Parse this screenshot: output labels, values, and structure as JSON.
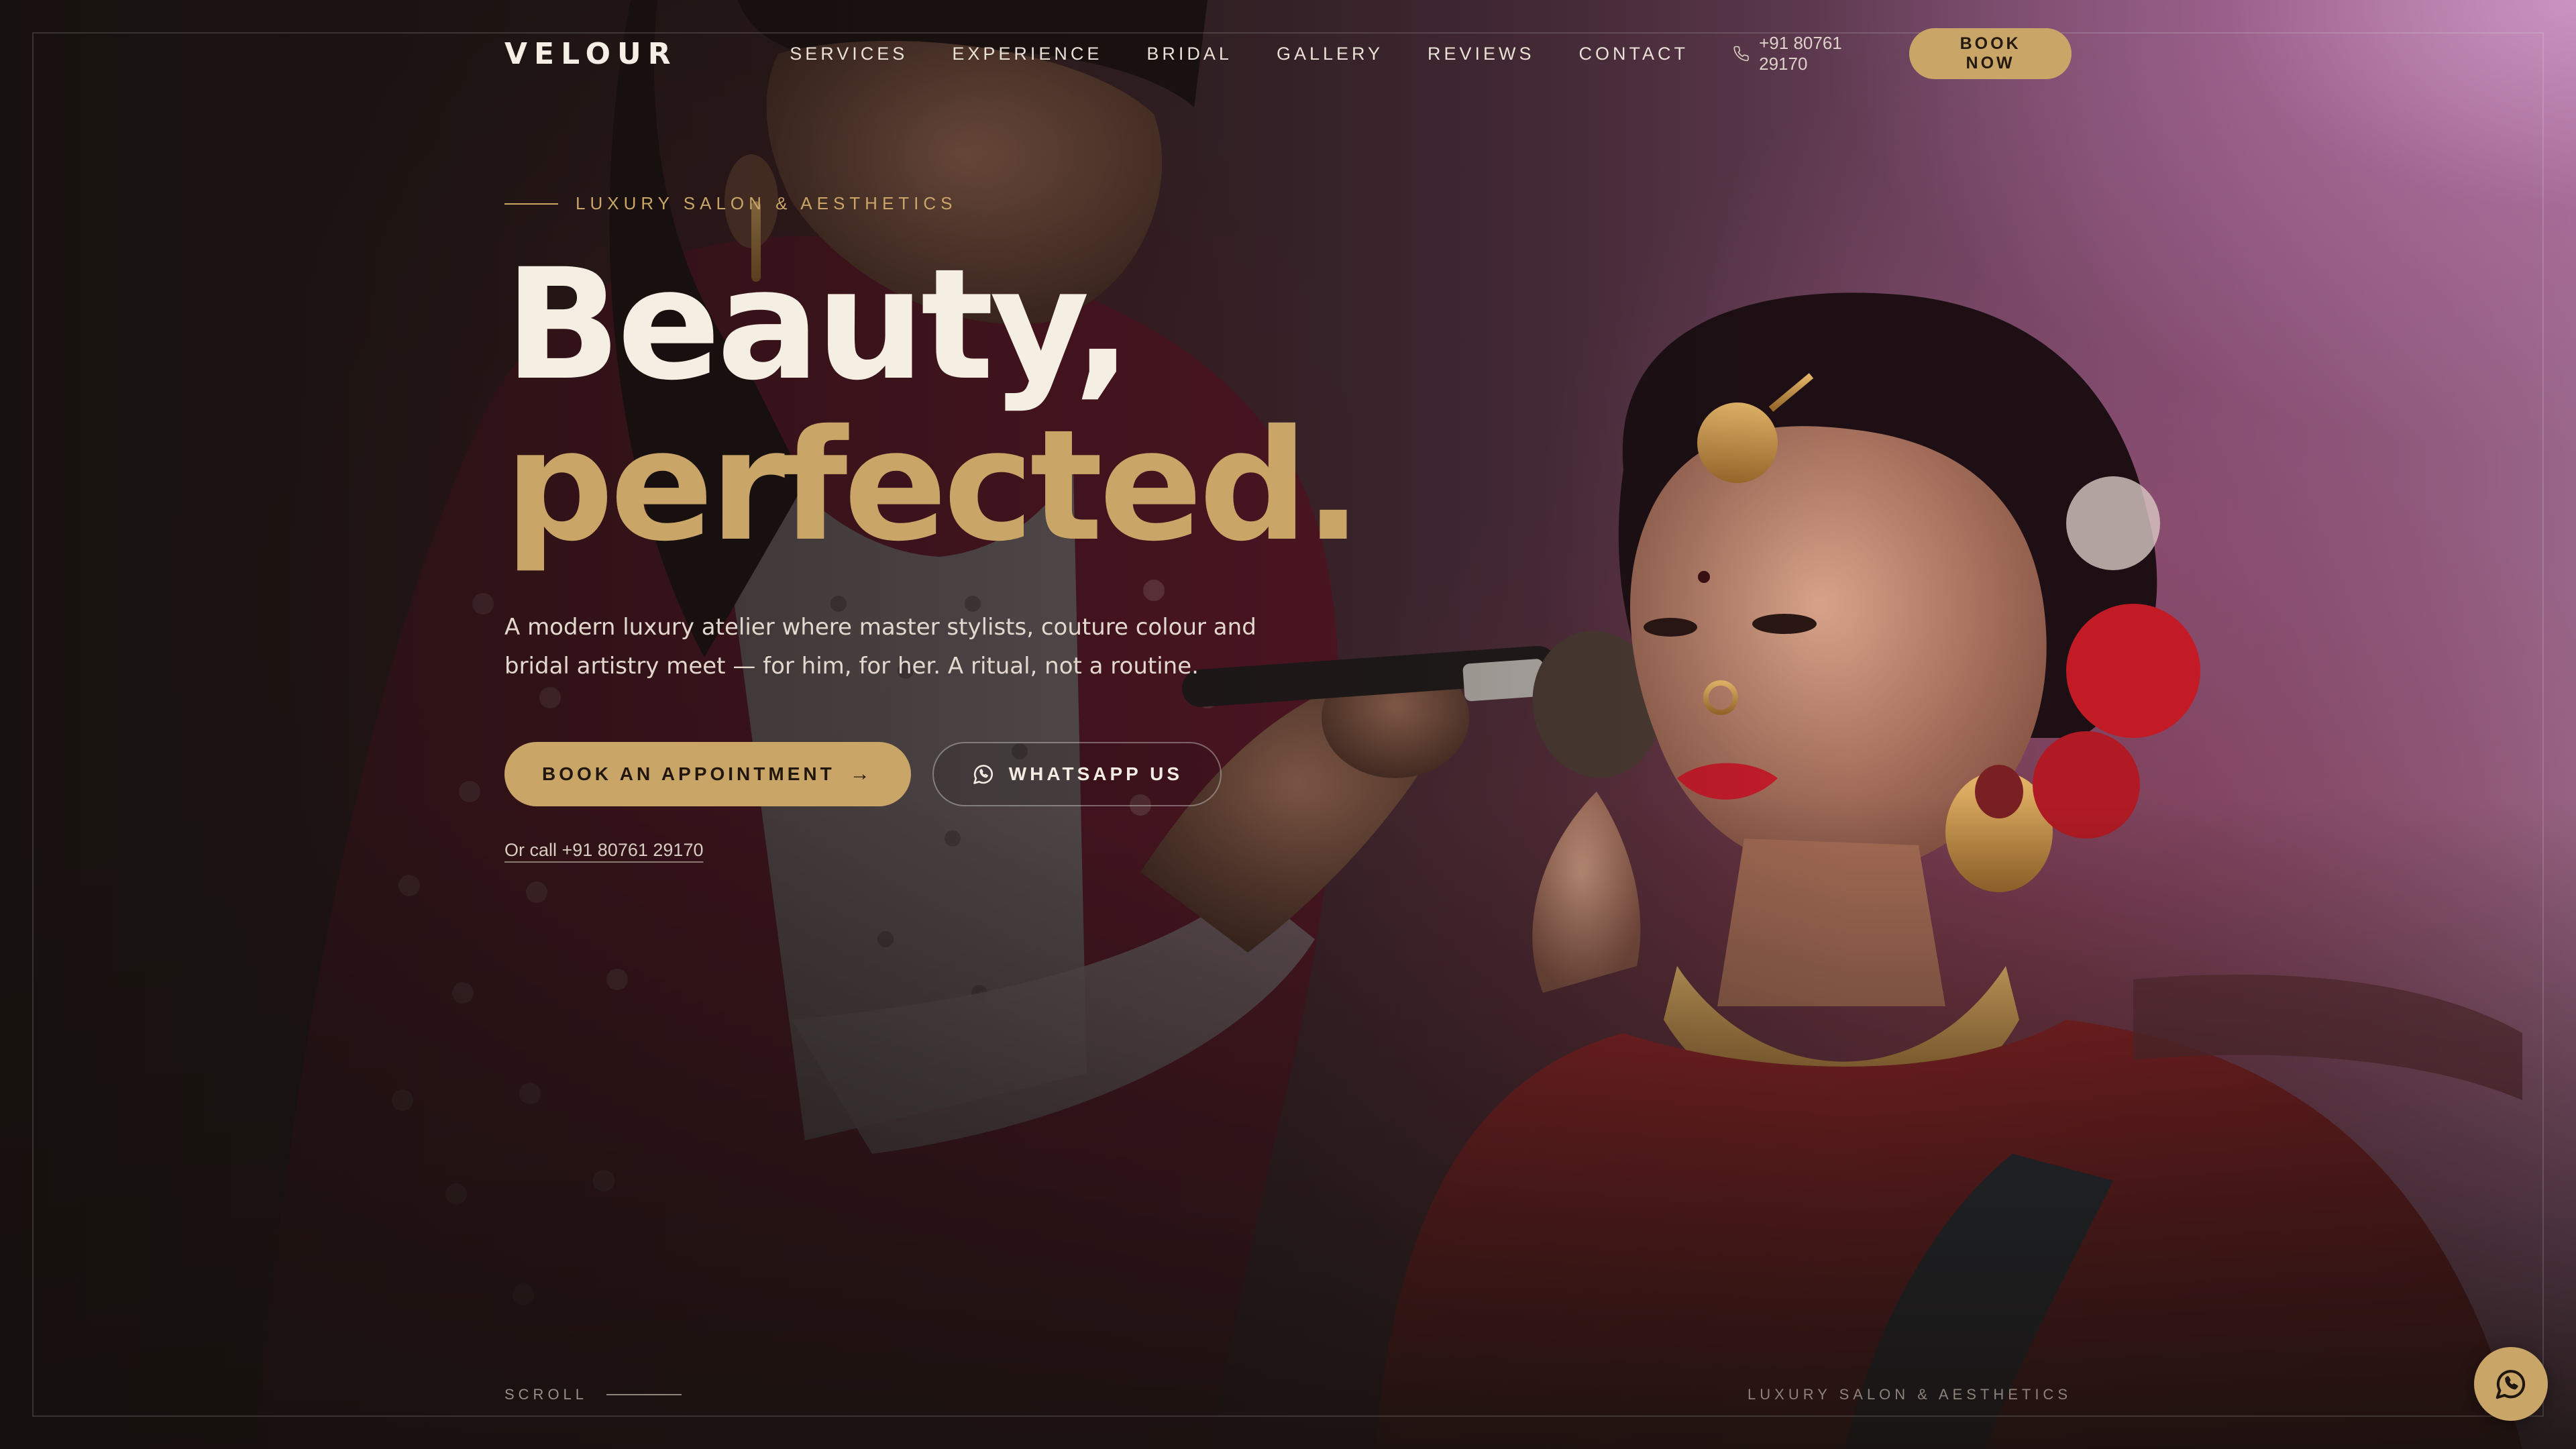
{
  "brand": {
    "logo": "VELOUR",
    "accent_color": "#c9a567",
    "background_color": "#1d1512"
  },
  "nav": {
    "links": [
      "SERVICES",
      "EXPERIENCE",
      "BRIDAL",
      "GALLERY",
      "REVIEWS",
      "CONTACT"
    ],
    "phone": "+91 80761 29170",
    "phone_icon": "phone-icon",
    "book_now": "BOOK NOW"
  },
  "hero": {
    "eyebrow": "LUXURY SALON & AESTHETICS",
    "headline_line1": "Beauty,",
    "headline_line2": "perfected.",
    "subtitle": "A modern luxury atelier where master stylists, couture colour and bridal artistry meet — for him, for her. A ritual, not a routine.",
    "primary_cta": "BOOK AN APPOINTMENT",
    "primary_cta_icon": "arrow-right-icon",
    "secondary_cta": "WHATSAPP US",
    "secondary_cta_icon": "whatsapp-icon",
    "or_call": "Or call +91 80761 29170"
  },
  "footer": {
    "scroll_label": "SCROLL",
    "tagline": "LUXURY SALON & AESTHETICS",
    "floating_button_icon": "whatsapp-icon"
  }
}
